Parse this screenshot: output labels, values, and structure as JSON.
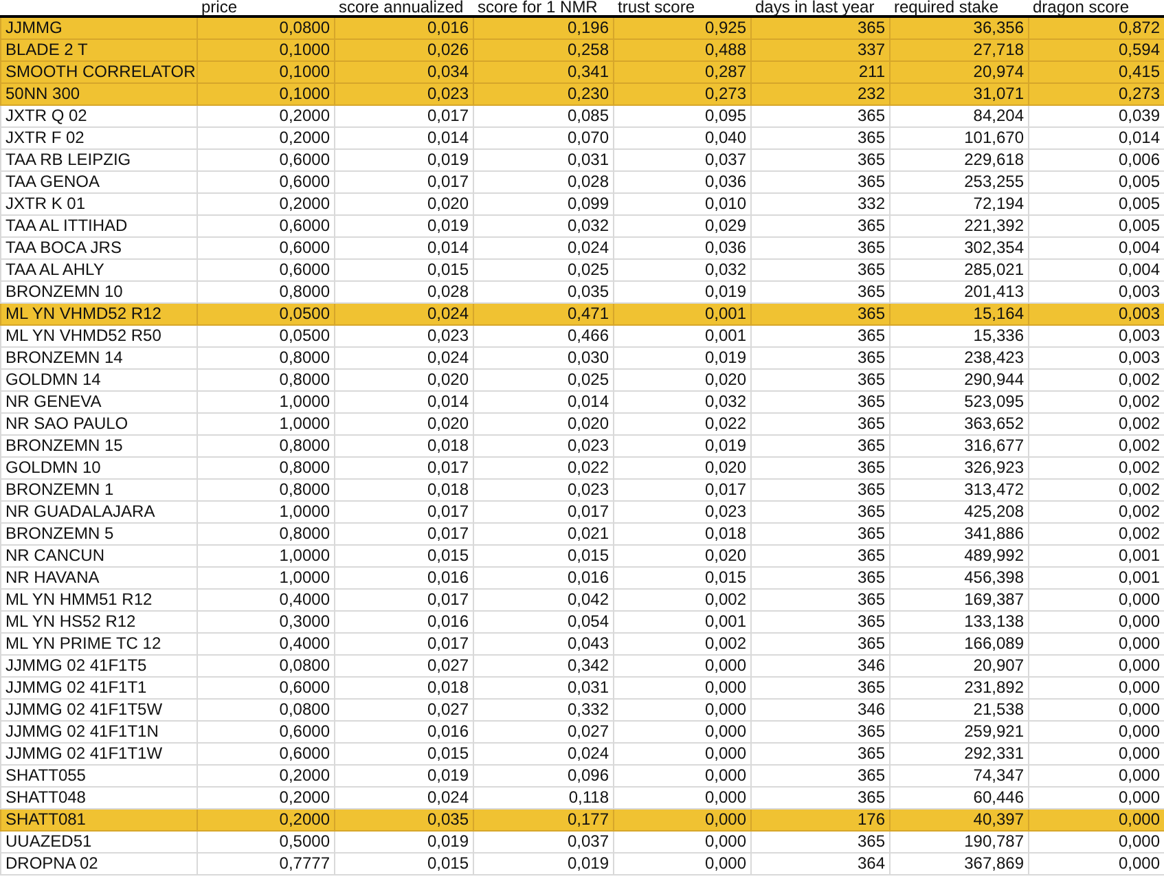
{
  "table": {
    "columns": [
      "price",
      "score annualized",
      "score for 1 NMR",
      "trust score",
      "days in last year",
      "required stake",
      "dragon score"
    ],
    "rows": [
      {
        "name": "JJMMG",
        "cells": [
          "0,0800",
          "0,016",
          "0,196",
          "0,925",
          "365",
          "36,356",
          "0,872"
        ],
        "highlighted": true
      },
      {
        "name": "BLADE 2 T",
        "cells": [
          "0,1000",
          "0,026",
          "0,258",
          "0,488",
          "337",
          "27,718",
          "0,594"
        ],
        "highlighted": true
      },
      {
        "name": "SMOOTH CORRELATOR",
        "cells": [
          "0,1000",
          "0,034",
          "0,341",
          "0,287",
          "211",
          "20,974",
          "0,415"
        ],
        "highlighted": true
      },
      {
        "name": "50NN 300",
        "cells": [
          "0,1000",
          "0,023",
          "0,230",
          "0,273",
          "232",
          "31,071",
          "0,273"
        ],
        "highlighted": true
      },
      {
        "name": "JXTR Q 02",
        "cells": [
          "0,2000",
          "0,017",
          "0,085",
          "0,095",
          "365",
          "84,204",
          "0,039"
        ],
        "highlighted": false
      },
      {
        "name": "JXTR F 02",
        "cells": [
          "0,2000",
          "0,014",
          "0,070",
          "0,040",
          "365",
          "101,670",
          "0,014"
        ],
        "highlighted": false
      },
      {
        "name": "TAA RB LEIPZIG",
        "cells": [
          "0,6000",
          "0,019",
          "0,031",
          "0,037",
          "365",
          "229,618",
          "0,006"
        ],
        "highlighted": false
      },
      {
        "name": "TAA GENOA",
        "cells": [
          "0,6000",
          "0,017",
          "0,028",
          "0,036",
          "365",
          "253,255",
          "0,005"
        ],
        "highlighted": false
      },
      {
        "name": "JXTR K 01",
        "cells": [
          "0,2000",
          "0,020",
          "0,099",
          "0,010",
          "332",
          "72,194",
          "0,005"
        ],
        "highlighted": false
      },
      {
        "name": "TAA AL ITTIHAD",
        "cells": [
          "0,6000",
          "0,019",
          "0,032",
          "0,029",
          "365",
          "221,392",
          "0,005"
        ],
        "highlighted": false
      },
      {
        "name": "TAA BOCA JRS",
        "cells": [
          "0,6000",
          "0,014",
          "0,024",
          "0,036",
          "365",
          "302,354",
          "0,004"
        ],
        "highlighted": false
      },
      {
        "name": "TAA AL AHLY",
        "cells": [
          "0,6000",
          "0,015",
          "0,025",
          "0,032",
          "365",
          "285,021",
          "0,004"
        ],
        "highlighted": false
      },
      {
        "name": "BRONZEMN 10",
        "cells": [
          "0,8000",
          "0,028",
          "0,035",
          "0,019",
          "365",
          "201,413",
          "0,003"
        ],
        "highlighted": false
      },
      {
        "name": "ML YN VHMD52 R12",
        "cells": [
          "0,0500",
          "0,024",
          "0,471",
          "0,001",
          "365",
          "15,164",
          "0,003"
        ],
        "highlighted": true
      },
      {
        "name": "ML YN VHMD52 R50",
        "cells": [
          "0,0500",
          "0,023",
          "0,466",
          "0,001",
          "365",
          "15,336",
          "0,003"
        ],
        "highlighted": false
      },
      {
        "name": "BRONZEMN 14",
        "cells": [
          "0,8000",
          "0,024",
          "0,030",
          "0,019",
          "365",
          "238,423",
          "0,003"
        ],
        "highlighted": false
      },
      {
        "name": "GOLDMN 14",
        "cells": [
          "0,8000",
          "0,020",
          "0,025",
          "0,020",
          "365",
          "290,944",
          "0,002"
        ],
        "highlighted": false
      },
      {
        "name": "NR GENEVA",
        "cells": [
          "1,0000",
          "0,014",
          "0,014",
          "0,032",
          "365",
          "523,095",
          "0,002"
        ],
        "highlighted": false
      },
      {
        "name": "NR SAO PAULO",
        "cells": [
          "1,0000",
          "0,020",
          "0,020",
          "0,022",
          "365",
          "363,652",
          "0,002"
        ],
        "highlighted": false
      },
      {
        "name": "BRONZEMN 15",
        "cells": [
          "0,8000",
          "0,018",
          "0,023",
          "0,019",
          "365",
          "316,677",
          "0,002"
        ],
        "highlighted": false
      },
      {
        "name": "GOLDMN 10",
        "cells": [
          "0,8000",
          "0,017",
          "0,022",
          "0,020",
          "365",
          "326,923",
          "0,002"
        ],
        "highlighted": false
      },
      {
        "name": "BRONZEMN 1",
        "cells": [
          "0,8000",
          "0,018",
          "0,023",
          "0,017",
          "365",
          "313,472",
          "0,002"
        ],
        "highlighted": false
      },
      {
        "name": "NR GUADALAJARA",
        "cells": [
          "1,0000",
          "0,017",
          "0,017",
          "0,023",
          "365",
          "425,208",
          "0,002"
        ],
        "highlighted": false
      },
      {
        "name": "BRONZEMN 5",
        "cells": [
          "0,8000",
          "0,017",
          "0,021",
          "0,018",
          "365",
          "341,886",
          "0,002"
        ],
        "highlighted": false
      },
      {
        "name": "NR CANCUN",
        "cells": [
          "1,0000",
          "0,015",
          "0,015",
          "0,020",
          "365",
          "489,992",
          "0,001"
        ],
        "highlighted": false
      },
      {
        "name": "NR HAVANA",
        "cells": [
          "1,0000",
          "0,016",
          "0,016",
          "0,015",
          "365",
          "456,398",
          "0,001"
        ],
        "highlighted": false
      },
      {
        "name": "ML YN HMM51 R12",
        "cells": [
          "0,4000",
          "0,017",
          "0,042",
          "0,002",
          "365",
          "169,387",
          "0,000"
        ],
        "highlighted": false
      },
      {
        "name": "ML YN HS52 R12",
        "cells": [
          "0,3000",
          "0,016",
          "0,054",
          "0,001",
          "365",
          "133,138",
          "0,000"
        ],
        "highlighted": false
      },
      {
        "name": "ML YN PRIME TC 12",
        "cells": [
          "0,4000",
          "0,017",
          "0,043",
          "0,002",
          "365",
          "166,089",
          "0,000"
        ],
        "highlighted": false
      },
      {
        "name": "JJMMG 02 41F1T5",
        "cells": [
          "0,0800",
          "0,027",
          "0,342",
          "0,000",
          "346",
          "20,907",
          "0,000"
        ],
        "highlighted": false
      },
      {
        "name": "JJMMG 02 41F1T1",
        "cells": [
          "0,6000",
          "0,018",
          "0,031",
          "0,000",
          "365",
          "231,892",
          "0,000"
        ],
        "highlighted": false
      },
      {
        "name": "JJMMG 02 41F1T5W",
        "cells": [
          "0,0800",
          "0,027",
          "0,332",
          "0,000",
          "346",
          "21,538",
          "0,000"
        ],
        "highlighted": false
      },
      {
        "name": "JJMMG 02 41F1T1N",
        "cells": [
          "0,6000",
          "0,016",
          "0,027",
          "0,000",
          "365",
          "259,921",
          "0,000"
        ],
        "highlighted": false
      },
      {
        "name": "JJMMG 02 41F1T1W",
        "cells": [
          "0,6000",
          "0,015",
          "0,024",
          "0,000",
          "365",
          "292,331",
          "0,000"
        ],
        "highlighted": false
      },
      {
        "name": "SHATT055",
        "cells": [
          "0,2000",
          "0,019",
          "0,096",
          "0,000",
          "365",
          "74,347",
          "0,000"
        ],
        "highlighted": false
      },
      {
        "name": "SHATT048",
        "cells": [
          "0,2000",
          "0,024",
          "0,118",
          "0,000",
          "365",
          "60,446",
          "0,000"
        ],
        "highlighted": false
      },
      {
        "name": "SHATT081",
        "cells": [
          "0,2000",
          "0,035",
          "0,177",
          "0,000",
          "176",
          "40,397",
          "0,000"
        ],
        "highlighted": true
      },
      {
        "name": "UUAZED51",
        "cells": [
          "0,5000",
          "0,019",
          "0,037",
          "0,000",
          "365",
          "190,787",
          "0,000"
        ],
        "highlighted": false
      },
      {
        "name": "DROPNA 02",
        "cells": [
          "0,7777",
          "0,015",
          "0,019",
          "0,000",
          "364",
          "367,869",
          "0,000"
        ],
        "highlighted": false
      }
    ]
  }
}
